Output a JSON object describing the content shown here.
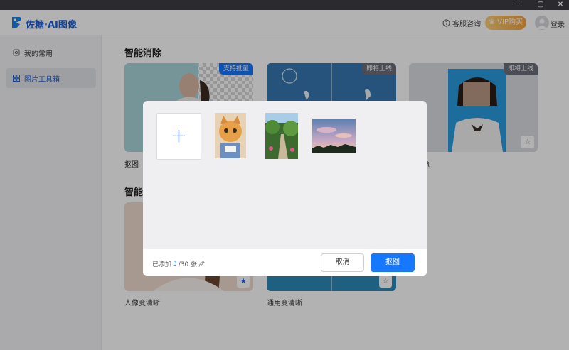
{
  "window": {
    "minimize": "─",
    "maximize": "▢",
    "close": "✕"
  },
  "header": {
    "brand": "佐糖·AI图像",
    "service": "客服咨询",
    "vip": "VIP购买",
    "login": "登录"
  },
  "sidebar": {
    "items": [
      {
        "label": "我的常用",
        "icon": "favorites-icon"
      },
      {
        "label": "图片工具箱",
        "icon": "grid-icon"
      }
    ]
  },
  "main": {
    "section1_title": "智能消除",
    "section2_title": "智能变",
    "cards": [
      {
        "label": "抠图",
        "badge": "支持批量",
        "badge_color": "#1677ff"
      },
      {
        "label": "",
        "badge": "即将上线",
        "badge_color": "#6b6f7a"
      },
      {
        "label": "像",
        "badge": "即将上线",
        "badge_color": "#6b6f7a"
      },
      {
        "label": "人像变清晰"
      },
      {
        "label": "通用变清晰"
      }
    ]
  },
  "dialog": {
    "count_prefix": "已添加",
    "count_current": "3",
    "count_suffix": "/30 张",
    "cancel": "取消",
    "confirm": "抠图"
  },
  "colors": {
    "accent": "#1677ff",
    "brand": "#1f5fd6",
    "vip": "#f4a13c"
  }
}
